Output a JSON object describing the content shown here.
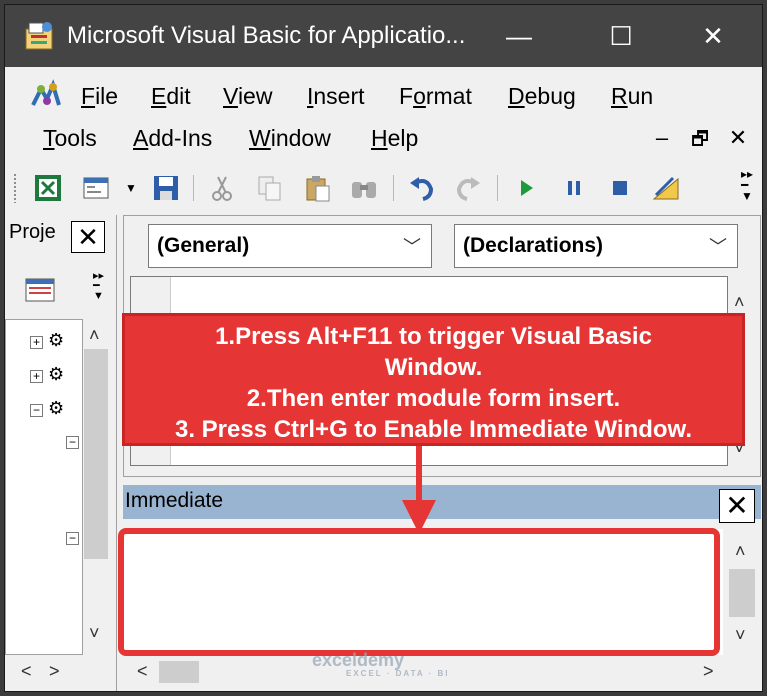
{
  "window": {
    "title": "Microsoft Visual Basic for Applicatio...",
    "controls": {
      "minimize": "—",
      "maximize": "☐",
      "close": "✕"
    }
  },
  "menubar": {
    "items": [
      {
        "pre": "",
        "key": "F",
        "post": "ile"
      },
      {
        "pre": "",
        "key": "E",
        "post": "dit"
      },
      {
        "pre": "",
        "key": "V",
        "post": "iew"
      },
      {
        "pre": "",
        "key": "I",
        "post": "nsert"
      },
      {
        "pre": "F",
        "key": "o",
        "post": "rmat"
      },
      {
        "pre": "",
        "key": "D",
        "post": "ebug"
      },
      {
        "pre": "",
        "key": "R",
        "post": "un"
      },
      {
        "pre": "",
        "key": "T",
        "post": "ools"
      },
      {
        "pre": "",
        "key": "A",
        "post": "dd-Ins"
      },
      {
        "pre": "",
        "key": "W",
        "post": "indow"
      },
      {
        "pre": "",
        "key": "H",
        "post": "elp"
      }
    ],
    "mdi_controls": {
      "minimize": "–",
      "restore": "🗗",
      "close": "✕"
    }
  },
  "toolbar": {
    "icons": [
      "excel-icon",
      "insert-module-icon",
      "save-icon",
      "cut-icon",
      "copy-icon",
      "paste-icon",
      "find-icon",
      "undo-icon",
      "redo-icon",
      "run-icon",
      "break-icon",
      "reset-icon",
      "design-mode-icon"
    ]
  },
  "project": {
    "title": "Proje",
    "close": "✕"
  },
  "code_window": {
    "object_combo": "(General)",
    "procedure_combo": "(Declarations)"
  },
  "immediate": {
    "title": "Immediate",
    "close": "✕"
  },
  "annotation": {
    "line1": "1.Press Alt+F11 to trigger Visual Basic",
    "line2": "Window.",
    "line3": "2.Then enter module form insert.",
    "line4": "3. Press Ctrl+G to Enable Immediate Window."
  },
  "watermark": {
    "brand": "exceldemy",
    "tagline": "EXCEL · DATA · BI"
  },
  "colors": {
    "titlebar": "#444444",
    "immediate_titlebar": "#99b4d1",
    "annotation_red": "#e53535"
  }
}
